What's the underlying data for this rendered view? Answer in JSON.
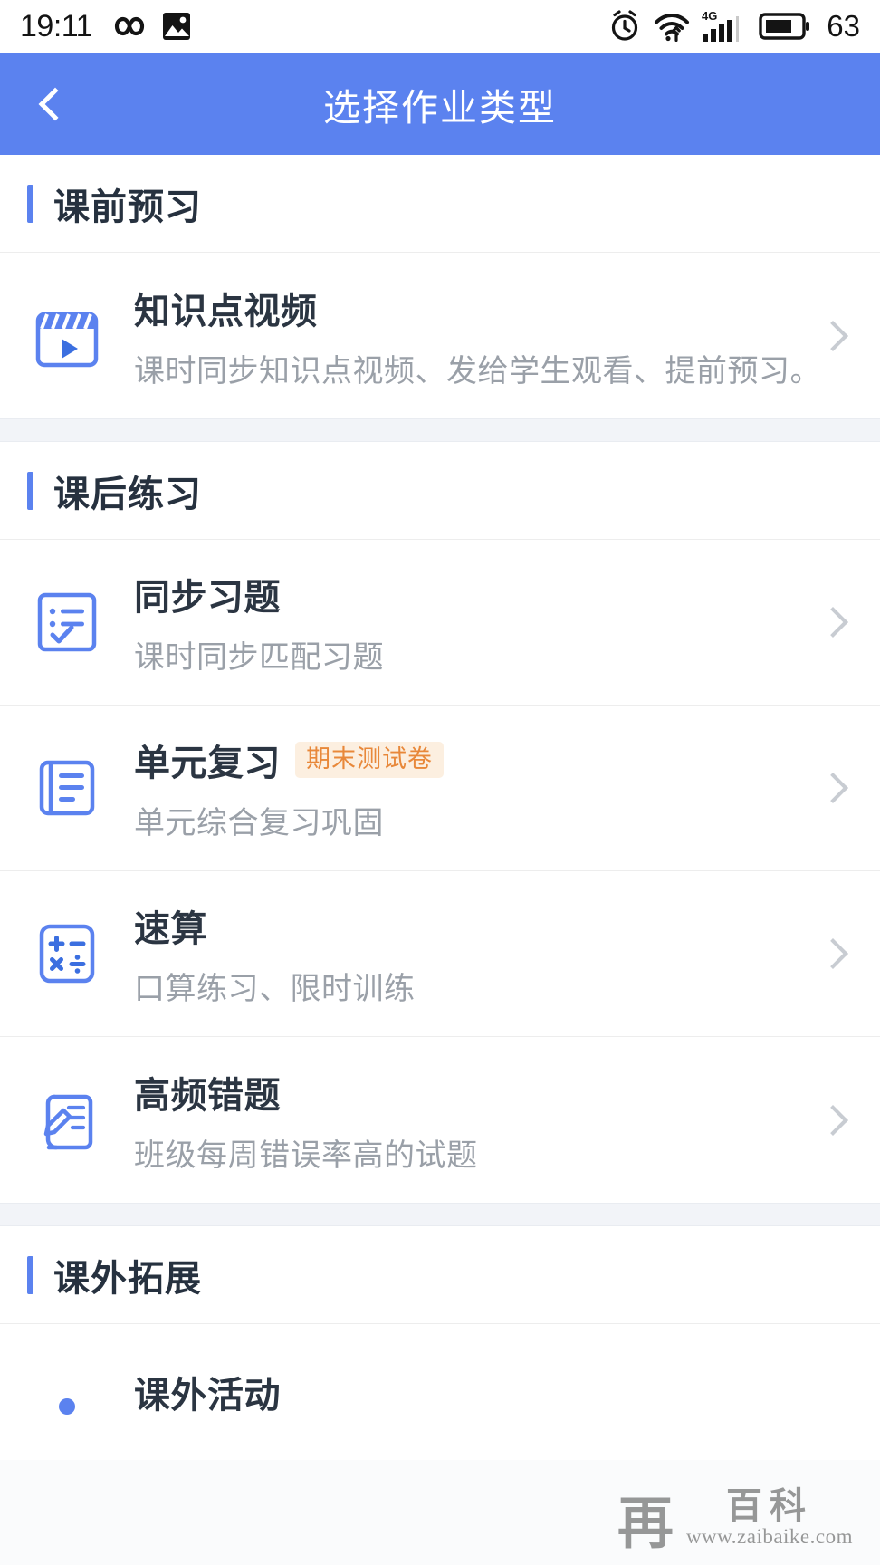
{
  "statusbar": {
    "time": "19:11",
    "battery_percent": "63",
    "network": "4G",
    "icons": [
      "infinity-icon",
      "image-icon",
      "alarm-icon",
      "wifi-icon",
      "signal-icon",
      "battery-icon"
    ]
  },
  "header": {
    "title": "选择作业类型",
    "back_label": "返回",
    "background_color": "#5b82ef"
  },
  "sections": [
    {
      "title": "课前预习",
      "rows": [
        {
          "title": "知识点视频",
          "subtitle": "课时同步知识点视频、发给学生观看、提前预习。",
          "icon": "video-clapperboard-icon",
          "badge": ""
        }
      ]
    },
    {
      "title": "课后练习",
      "rows": [
        {
          "title": "同步习题",
          "subtitle": "课时同步匹配习题",
          "icon": "checklist-icon",
          "badge": ""
        },
        {
          "title": "单元复习",
          "subtitle": "单元综合复习巩固",
          "icon": "book-icon",
          "badge": "期末测试卷"
        },
        {
          "title": "速算",
          "subtitle": "口算练习、限时训练",
          "icon": "calculator-icon",
          "badge": ""
        },
        {
          "title": "高频错题",
          "subtitle": "班级每周错误率高的试题",
          "icon": "scroll-pencil-icon",
          "badge": ""
        }
      ]
    },
    {
      "title": "课外拓展",
      "rows": [
        {
          "title": "课外活动",
          "subtitle": "",
          "icon": "activity-icon",
          "badge": ""
        }
      ]
    }
  ],
  "watermark": {
    "mark": "再",
    "name": "百科",
    "url": "www.zaibaike.com"
  },
  "colors": {
    "accent": "#5b82ef",
    "badge_text": "#e8883a",
    "badge_bg": "#fcefe0",
    "title_text": "#2b3542",
    "sub_text": "#9aa0a8"
  }
}
